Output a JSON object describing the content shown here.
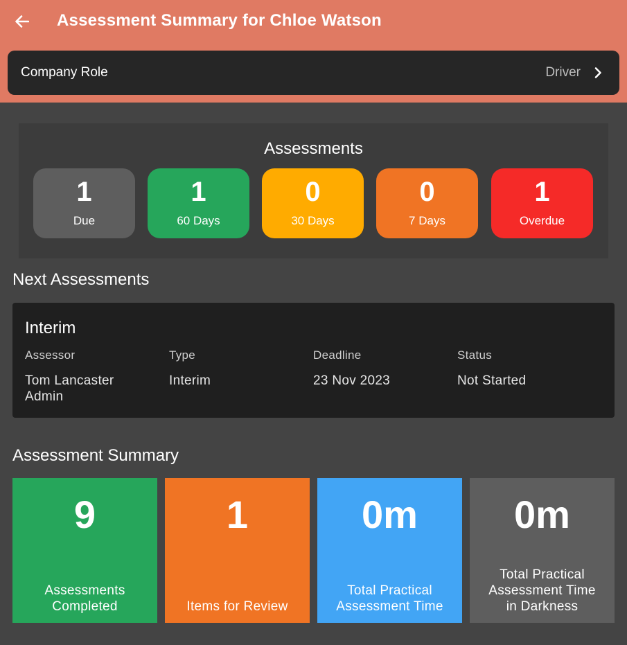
{
  "header": {
    "title": "Assessment Summary for Chloe Watson",
    "back_icon": "arrow-left-icon",
    "bg_color": "#e07a63"
  },
  "company_role": {
    "label": "Company Role",
    "value": "Driver",
    "chevron_icon": "chevron-right-icon"
  },
  "assessments": {
    "title": "Assessments",
    "tiles": [
      {
        "count": "1",
        "label": "Due",
        "color": "#5e5e5e"
      },
      {
        "count": "1",
        "label": "60 Days",
        "color": "#26a65b"
      },
      {
        "count": "0",
        "label": "30 Days",
        "color": "#ffab00"
      },
      {
        "count": "0",
        "label": "7 Days",
        "color": "#f07424"
      },
      {
        "count": "1",
        "label": "Overdue",
        "color": "#f52a28"
      }
    ]
  },
  "next_assessments": {
    "heading": "Next Assessments",
    "card": {
      "title": "Interim",
      "columns": [
        {
          "header": "Assessor",
          "value": "Tom Lancaster Admin"
        },
        {
          "header": "Type",
          "value": "Interim"
        },
        {
          "header": "Deadline",
          "value": "23 Nov 2023"
        },
        {
          "header": "Status",
          "value": "Not Started"
        }
      ]
    }
  },
  "assessment_summary": {
    "heading": "Assessment Summary",
    "tiles": [
      {
        "value": "9",
        "label": "Assessments Completed",
        "color": "#26a65b"
      },
      {
        "value": "1",
        "label": "Items for Review",
        "color": "#f07424"
      },
      {
        "value": "0m",
        "label": "Total Practical Assessment Time",
        "color": "#42a5f5"
      },
      {
        "value": "0m",
        "label": "Total Practical Assessment Time in Darkness",
        "color": "#5e5e5e"
      }
    ]
  }
}
